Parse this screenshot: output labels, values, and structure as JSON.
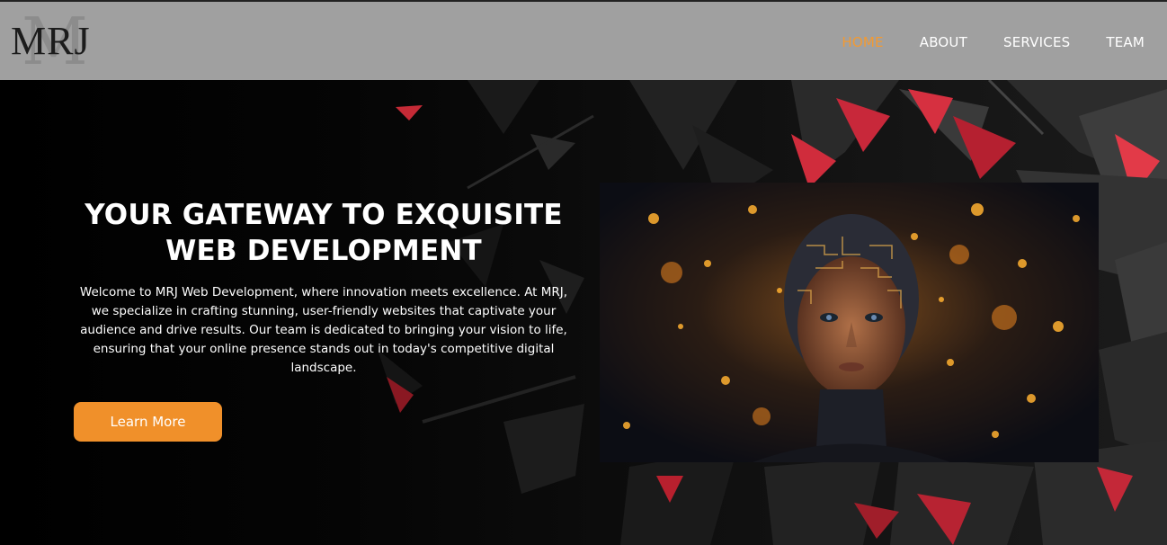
{
  "header": {
    "logo_text": "MRJ",
    "logo_bg_letter": "M"
  },
  "nav": {
    "items": [
      {
        "label": "HOME",
        "active": true
      },
      {
        "label": "ABOUT",
        "active": false
      },
      {
        "label": "SERVICES",
        "active": false
      },
      {
        "label": "TEAM",
        "active": false
      }
    ]
  },
  "hero": {
    "title_line1": "YOUR GATEWAY TO EXQUISITE",
    "title_line2": "WEB DEVELOPMENT",
    "description": "Welcome to MRJ Web Development, where innovation meets excellence. At MRJ, we specialize in crafting stunning, user-friendly websites that captivate your audience and drive results. Our team is dedicated to bringing your vision to life, ensuring that your online presence stands out in today's competitive digital landscape.",
    "button_label": "Learn More",
    "image_icon": "ai-face-portrait"
  },
  "colors": {
    "header_bg": "#a0a0a0",
    "accent": "#f0902a",
    "nav_active": "#f29a33",
    "hero_bg": "#000000"
  }
}
